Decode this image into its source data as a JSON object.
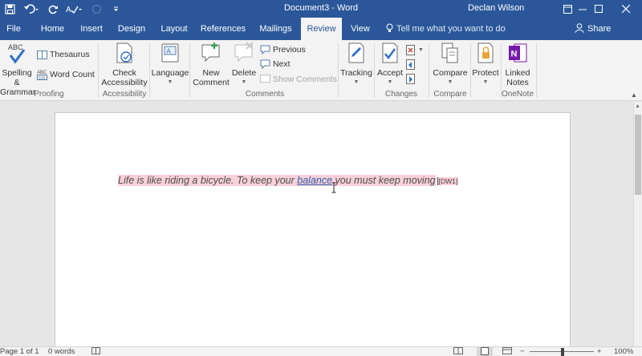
{
  "titlebar": {
    "title": "Document3 - Word",
    "user": "Declan Wilson",
    "bg": "#2b579a"
  },
  "tabs": {
    "file": "File",
    "home": "Home",
    "insert": "Insert",
    "design": "Design",
    "layout": "Layout",
    "references": "References",
    "mailings": "Mailings",
    "review": "Review",
    "view": "View",
    "tell_me": "Tell me what you want to do",
    "share": "Share"
  },
  "ribbon": {
    "spelling_line1": "Spelling &",
    "spelling_line2": "Grammar",
    "thesaurus": "Thesaurus",
    "word_count": "Word Count",
    "proofing": "Proofing",
    "check_access_line1": "Check",
    "check_access_line2": "Accessibility",
    "accessibility": "Accessibility",
    "language": "Language",
    "new_comment_line1": "New",
    "new_comment_line2": "Comment",
    "delete": "Delete",
    "previous": "Previous",
    "next": "Next",
    "show_comments": "Show Comments",
    "comments": "Comments",
    "tracking": "Tracking",
    "accept": "Accept",
    "changes": "Changes",
    "compare": "Compare",
    "compare_group": "Compare",
    "protect": "Protect",
    "linked_line1": "Linked",
    "linked_line2": "Notes",
    "onenote": "OneNote"
  },
  "document": {
    "text_before": "Life is like riding a bicycle. To keep your ",
    "text_link": "balance",
    "text_after": " you must keep moving",
    "comment_marker": "[DW1]",
    "highlight_color": "#f8d0da"
  },
  "status": {
    "page": "Page 1 of 1",
    "words": "0 words",
    "zoom": "100%"
  }
}
